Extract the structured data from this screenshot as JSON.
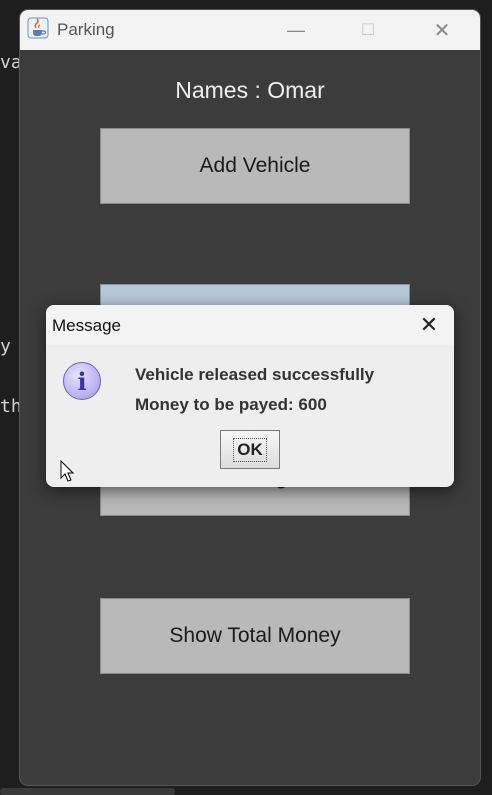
{
  "background": {
    "fragments": [
      "va",
      "y",
      "th"
    ]
  },
  "window": {
    "title": "Parking",
    "icon": "java-cup-icon",
    "controls": {
      "minimize": "—",
      "maximize": "☐",
      "close": "✕"
    }
  },
  "main": {
    "names_label": "Names : Omar",
    "buttons": {
      "add_vehicle": "Add Vehicle",
      "release_vehicle": "",
      "show_parking_status": "Show Parking Status",
      "show_total_money": "Show Total Money"
    }
  },
  "dialog": {
    "title": "Message",
    "close": "✕",
    "icon": "info-icon",
    "icon_glyph": "i",
    "line1": "Vehicle released successfully",
    "line2": "Money to be payed: 600",
    "ok_label": "OK"
  },
  "colors": {
    "window_bg": "#3c3c3c",
    "button_bg": "#b9b9b9",
    "focused_button_bg": "#b8c8d8",
    "dialog_bg": "#eeeeee"
  }
}
